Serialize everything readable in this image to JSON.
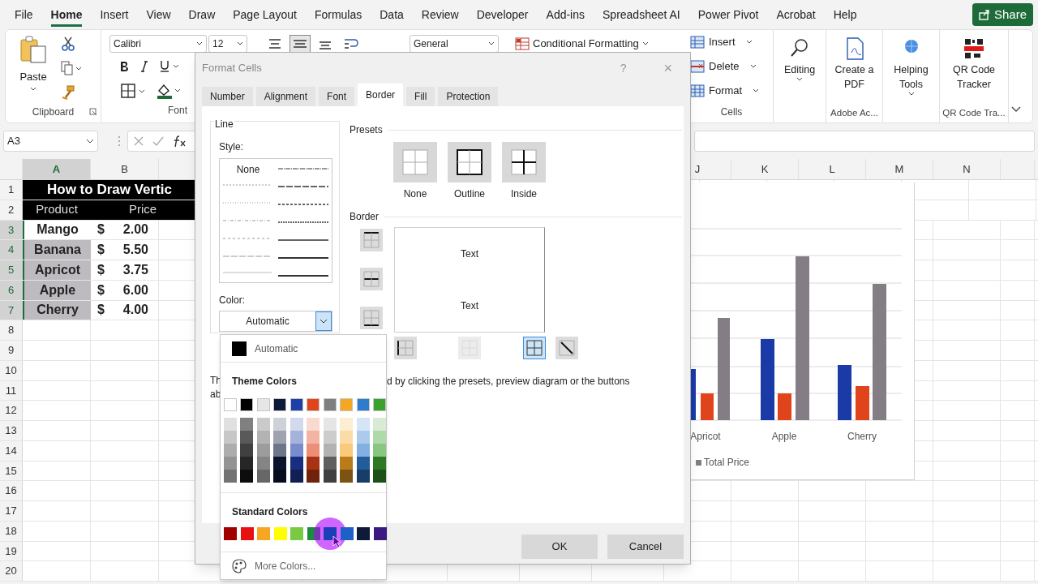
{
  "ribbon_tabs": [
    {
      "label": "File",
      "selected": false
    },
    {
      "label": "Home",
      "selected": true
    },
    {
      "label": "Insert",
      "selected": false
    },
    {
      "label": "View",
      "selected": false
    },
    {
      "label": "Draw",
      "selected": false
    },
    {
      "label": "Page Layout",
      "selected": false
    },
    {
      "label": "Formulas",
      "selected": false
    },
    {
      "label": "Data",
      "selected": false
    },
    {
      "label": "Review",
      "selected": false
    },
    {
      "label": "Developer",
      "selected": false
    },
    {
      "label": "Add-ins",
      "selected": false
    },
    {
      "label": "Spreadsheet AI",
      "selected": false
    },
    {
      "label": "Power Pivot",
      "selected": false
    },
    {
      "label": "Acrobat",
      "selected": false
    },
    {
      "label": "Help",
      "selected": false
    }
  ],
  "share_button": "Share",
  "ribbon": {
    "paste": "Paste",
    "clipboard_label": "Clipboard",
    "font_name": "Calibri",
    "font_size": "12",
    "font_label": "Font",
    "number_format": "General",
    "conditional_formatting": "Conditional Formatting",
    "cells": [
      "Insert",
      "Delete",
      "Format"
    ],
    "cells_label": "Cells",
    "editing": "Editing",
    "create_pdf": "Create a PDF",
    "adobe_label": "Adobe Ac...",
    "helping_tools": "Helping Tools",
    "qr_code": "QR Code Tracker",
    "qr_label": "QR Code Tra..."
  },
  "name_box": "A3",
  "columns": [
    {
      "label": "A",
      "selected": true
    },
    {
      "label": "B",
      "selected": false
    },
    {
      "label": "J",
      "selected": false
    },
    {
      "label": "K",
      "selected": false
    },
    {
      "label": "L",
      "selected": false
    },
    {
      "label": "M",
      "selected": false
    },
    {
      "label": "N",
      "selected": false
    }
  ],
  "rows": [
    {
      "number": "1",
      "selected": false,
      "cells": [
        {
          "kind": "title",
          "text": "How to Draw Vertic"
        }
      ]
    },
    {
      "number": "2",
      "selected": false,
      "cells": [
        {
          "kind": "header",
          "text": "Product"
        },
        {
          "kind": "header",
          "text": "Price"
        }
      ]
    },
    {
      "number": "3",
      "selected": true,
      "cells": [
        {
          "kind": "product",
          "text": "Mango",
          "selected": true,
          "active": true
        },
        {
          "kind": "price",
          "currency": "$",
          "amount": "2.00"
        }
      ]
    },
    {
      "number": "4",
      "selected": true,
      "cells": [
        {
          "kind": "product",
          "text": "Banana",
          "selected": true,
          "active": false
        },
        {
          "kind": "price",
          "currency": "$",
          "amount": "5.50"
        }
      ]
    },
    {
      "number": "5",
      "selected": true,
      "cells": [
        {
          "kind": "product",
          "text": "Apricot",
          "selected": true,
          "active": false
        },
        {
          "kind": "price",
          "currency": "$",
          "amount": "3.75"
        }
      ]
    },
    {
      "number": "6",
      "selected": true,
      "cells": [
        {
          "kind": "product",
          "text": "Apple",
          "selected": true,
          "active": false
        },
        {
          "kind": "price",
          "currency": "$",
          "amount": "6.00"
        }
      ]
    },
    {
      "number": "7",
      "selected": true,
      "cells": [
        {
          "kind": "product",
          "text": "Cherry",
          "selected": true,
          "active": false
        },
        {
          "kind": "price",
          "currency": "$",
          "amount": "4.00"
        }
      ]
    },
    {
      "number": "8",
      "selected": false
    },
    {
      "number": "9",
      "selected": false
    },
    {
      "number": "10",
      "selected": false
    },
    {
      "number": "11",
      "selected": false
    },
    {
      "number": "12",
      "selected": false
    },
    {
      "number": "13",
      "selected": false
    },
    {
      "number": "14",
      "selected": false
    },
    {
      "number": "15",
      "selected": false
    },
    {
      "number": "16",
      "selected": false
    },
    {
      "number": "17",
      "selected": false
    },
    {
      "number": "18",
      "selected": false
    },
    {
      "number": "19",
      "selected": false
    },
    {
      "number": "20",
      "selected": false
    }
  ],
  "chart": {
    "categories": [
      "Apricot",
      "Apple",
      "Cherry"
    ],
    "legend": "Total Price"
  },
  "dialog": {
    "title": "Format Cells",
    "help": "?",
    "close": "×",
    "tabs": [
      {
        "label": "Number",
        "selected": false
      },
      {
        "label": "Alignment",
        "selected": false
      },
      {
        "label": "Font",
        "selected": false
      },
      {
        "label": "Border",
        "selected": true
      },
      {
        "label": "Fill",
        "selected": false
      },
      {
        "label": "Protection",
        "selected": false
      }
    ],
    "line": {
      "label": "Line",
      "style_label": "Style:",
      "none_label": "None",
      "color_label": "Color:",
      "color_value": "Automatic"
    },
    "presets": {
      "label": "Presets",
      "items": [
        {
          "kind": "none",
          "label": "None"
        },
        {
          "kind": "outline",
          "label": "Outline"
        },
        {
          "kind": "inside",
          "label": "Inside"
        }
      ]
    },
    "border": {
      "label": "Border",
      "preview_texts": [
        "Text",
        "Text"
      ],
      "side_buttons": [
        {
          "kind": "top",
          "selected": false
        },
        {
          "kind": "middle",
          "selected": false
        },
        {
          "kind": "bottom",
          "selected": false
        }
      ],
      "bottom_buttons": [
        {
          "kind": "left",
          "selected": false,
          "disabled": false
        },
        {
          "kind": "center",
          "selected": false,
          "disabled": true
        },
        {
          "kind": "right",
          "selected": true,
          "disabled": false
        },
        {
          "kind": "diagonal",
          "selected": false,
          "disabled": false
        }
      ]
    },
    "hint_fragments": [
      "Th",
      "ab",
      "d by clicking the presets, preview diagram or the buttons"
    ],
    "buttons": [
      "OK",
      "Cancel"
    ]
  },
  "color_menu": {
    "automatic": "Automatic",
    "theme_title": "Theme Colors",
    "theme_colors": [
      {
        "color": "#ffffff"
      },
      {
        "color": "#000000"
      },
      {
        "color": "#e7e6e6"
      },
      {
        "color": "#0e1a3a"
      },
      {
        "color": "#1f3fa8"
      },
      {
        "color": "#e0441a"
      },
      {
        "color": "#7f7f7f"
      },
      {
        "color": "#f5a623"
      },
      {
        "color": "#2e7bcf"
      },
      {
        "color": "#3aa02e"
      }
    ],
    "standard_title": "Standard Colors",
    "standard_colors": [
      {
        "color": "#a00000",
        "hovered": false
      },
      {
        "color": "#e81010",
        "hovered": false
      },
      {
        "color": "#f5a623",
        "hovered": false
      },
      {
        "color": "#ffff00",
        "hovered": false
      },
      {
        "color": "#7ac943",
        "hovered": false
      },
      {
        "color": "#1e8a3c",
        "hovered": false
      },
      {
        "color": "#1b3fb8",
        "hovered": true
      },
      {
        "color": "#1f5fc8",
        "hovered": false
      },
      {
        "color": "#0e1a3a",
        "hovered": false
      },
      {
        "color": "#3a1a80",
        "hovered": false
      }
    ],
    "more": "More Colors..."
  }
}
